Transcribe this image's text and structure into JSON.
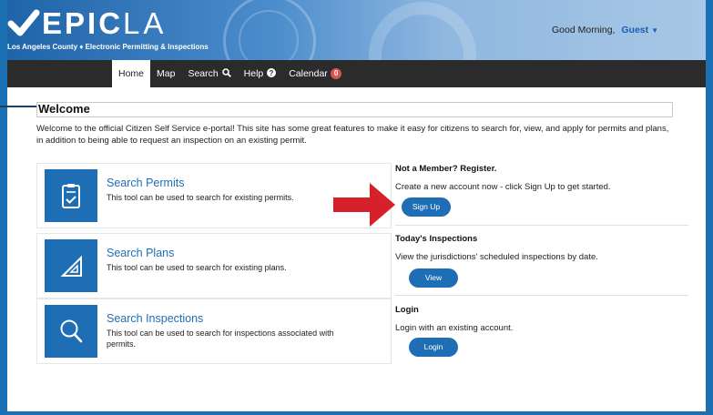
{
  "header": {
    "logo_main": "EPIC",
    "logo_suffix": "LA",
    "logo_subtitle": "Los Angeles County ♦ Electronic Permitting & Inspections",
    "greeting": "Good Morning,",
    "user": "Guest"
  },
  "nav": {
    "items": [
      {
        "label": "Home",
        "active": true
      },
      {
        "label": "Map"
      },
      {
        "label": "Search",
        "icon": "search-icon"
      },
      {
        "label": "Help",
        "icon": "help-icon"
      },
      {
        "label": "Calendar",
        "badge": "0"
      }
    ]
  },
  "welcome": {
    "title": "Welcome",
    "intro": "Welcome to the official Citizen Self Service e-portal! This site has some great features to make it easy for citizens to search for, view, and apply for permits and plans, in addition to being able to request an inspection on an existing permit."
  },
  "cards": [
    {
      "title": "Search Permits",
      "description": "This tool can be used to search for existing permits.",
      "icon": "clipboard-check-icon"
    },
    {
      "title": "Search Plans",
      "description": "This tool can be used to search for existing plans.",
      "icon": "triangle-ruler-icon"
    },
    {
      "title": "Search Inspections",
      "description": "This tool can be used to search for inspections associated with permits.",
      "icon": "magnifier-icon"
    }
  ],
  "side": {
    "register": {
      "title": "Not a Member? Register.",
      "text": "Create a new account now - click Sign Up to get started.",
      "button": "Sign Up"
    },
    "inspections": {
      "title": "Today's Inspections",
      "text": "View the jurisdictions' scheduled inspections by date.",
      "button": "View"
    },
    "login": {
      "title": "Login",
      "text": "Login with an existing account.",
      "button": "Login"
    }
  },
  "colors": {
    "brand_blue": "#1e6eb5",
    "nav_dark": "#2b2b2b",
    "badge_red": "#d9534f",
    "arrow_red": "#d7212a"
  }
}
